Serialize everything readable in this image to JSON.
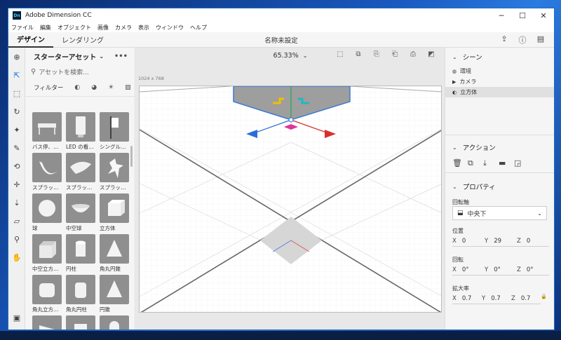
{
  "app": {
    "title": "Adobe Dimension CC",
    "icon_text": "Dn"
  },
  "window_controls": {
    "minimize": "─",
    "maximize": "☐",
    "close": "✕"
  },
  "menu": [
    "ファイル",
    "編集",
    "オブジェクト",
    "画像",
    "カメラ",
    "表示",
    "ウィンドウ",
    "ヘルプ"
  ],
  "tabs": {
    "design": "デザイン",
    "render": "レンダリング"
  },
  "document_title": "名称未設定",
  "assets": {
    "header": "スターターアセット",
    "search_placeholder": "アセットを検索...",
    "filter_label": "フィルター",
    "items": [
      {
        "label": "バス停、…",
        "shape": "bench"
      },
      {
        "label": "LED の看…",
        "shape": "sign"
      },
      {
        "label": "シングル…",
        "shape": "flag"
      },
      {
        "label": "スプラッ…",
        "shape": "splash1"
      },
      {
        "label": "スプラッ…",
        "shape": "splash2"
      },
      {
        "label": "スプラッ…",
        "shape": "splash3"
      },
      {
        "label": "球",
        "shape": "sphere"
      },
      {
        "label": "中空球",
        "shape": "bowl"
      },
      {
        "label": "立方体",
        "shape": "cube"
      },
      {
        "label": "中空立方…",
        "shape": "hollowcube"
      },
      {
        "label": "円柱",
        "shape": "cylinder"
      },
      {
        "label": "角丸円錐",
        "shape": "cone"
      },
      {
        "label": "角丸立方…",
        "shape": "roundcube"
      },
      {
        "label": "角丸円柱",
        "shape": "roundcyl"
      },
      {
        "label": "円錐",
        "shape": "cone"
      },
      {
        "label": "",
        "shape": "wedge"
      },
      {
        "label": "",
        "shape": "box2"
      },
      {
        "label": "",
        "shape": "capsule"
      }
    ]
  },
  "viewport": {
    "zoom": "65.33%",
    "canvas_size": "1024 x 768"
  },
  "scene": {
    "title": "シーン",
    "items": [
      {
        "label": "環境",
        "icon": "globe-icon",
        "selected": false
      },
      {
        "label": "カメラ",
        "icon": "camera-icon",
        "selected": false
      },
      {
        "label": "立方体",
        "icon": "cube-icon",
        "selected": true
      }
    ]
  },
  "actions": {
    "title": "アクション"
  },
  "properties": {
    "title": "プロパティ",
    "pivot_label": "回転軸",
    "pivot_value": "中央下",
    "position_label": "位置",
    "position": {
      "x": "0",
      "y": "29",
      "z": "0"
    },
    "rotation_label": "回転",
    "rotation": {
      "x": "0°",
      "y": "0°",
      "z": "0°"
    },
    "scale_label": "拡大率",
    "scale": {
      "x": "0.7",
      "y": "0.7",
      "z": "0.7"
    }
  },
  "colors": {
    "accent": "#1473e6",
    "thumb_bg": "#8f8f8f"
  }
}
